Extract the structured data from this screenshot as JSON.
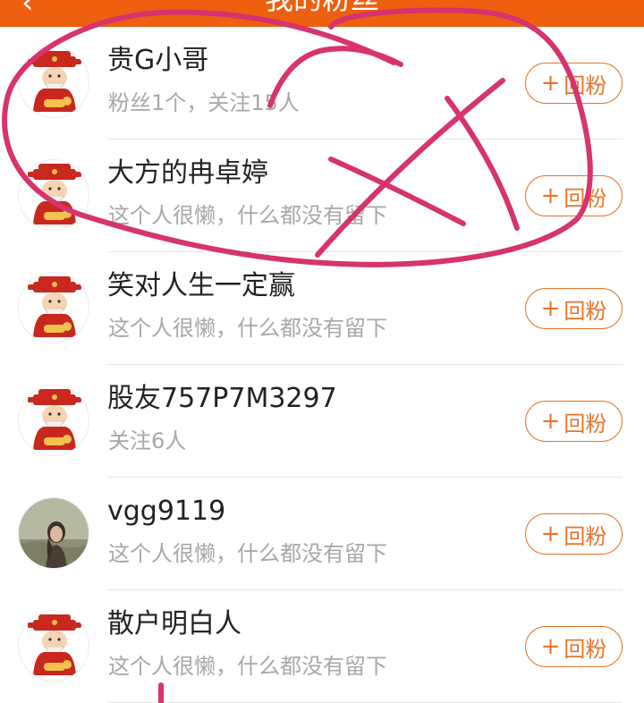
{
  "header": {
    "back_icon": "back-arrow-icon",
    "title": "我的粉丝"
  },
  "fans": [
    {
      "name": "贵G小哥",
      "subtitle": "粉丝1个，关注15人",
      "avatar": "fortune-god-icon",
      "button_label": "回粉"
    },
    {
      "name": "大方的冉卓婷",
      "subtitle": "这个人很懒，什么都没有留下",
      "avatar": "fortune-god-icon",
      "button_label": "回粉"
    },
    {
      "name": "笑对人生一定赢",
      "subtitle": "这个人很懒，什么都没有留下",
      "avatar": "fortune-god-icon",
      "button_label": "回粉"
    },
    {
      "name": "股友757P7M3297",
      "subtitle": "关注6人",
      "avatar": "fortune-god-icon",
      "button_label": "回粉"
    },
    {
      "name": "vgg9119",
      "subtitle": "这个人很懒，什么都没有留下",
      "avatar": "photo-avatar",
      "button_label": "回粉"
    },
    {
      "name": "散户明白人",
      "subtitle": "这个人很懒，什么都没有留下",
      "avatar": "fortune-god-icon",
      "button_label": "回粉"
    }
  ],
  "colors": {
    "header_bg": "#ee5f0f",
    "accent": "#e8742a",
    "annotation": "#d6336f"
  }
}
